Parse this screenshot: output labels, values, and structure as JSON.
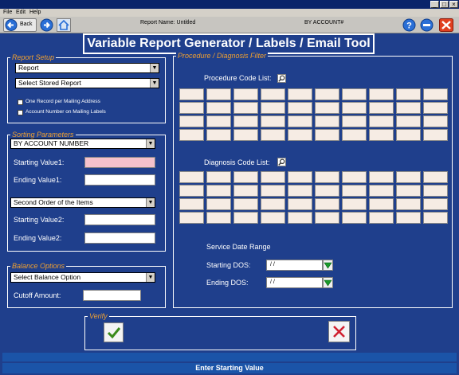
{
  "menu": {
    "file": "File",
    "edit": "Edit",
    "help": "Help"
  },
  "toolbar": {
    "back_label": "Back",
    "report_name": "Report Name: Untitled",
    "sort_info": "BY ACCOUNT#"
  },
  "header": {
    "title": "Variable Report Generator / Labels / Email Tool"
  },
  "report_setup": {
    "legend": "Report Setup",
    "report_type": "Report",
    "stored_report": "Select Stored Report",
    "one_record_label": "One Record per Mailing Address",
    "account_number_label": "Account Number on Mailing Labels"
  },
  "sorting": {
    "legend": "Sorting Parameters",
    "first_order": "BY ACCOUNT NUMBER",
    "starting_value1_label": "Starting Value1:",
    "ending_value1_label": "Ending   Value1:",
    "second_order": "Second Order of the Items",
    "starting_value2_label": "Starting Value2:",
    "ending_value2_label": "Ending   Value2:"
  },
  "balance": {
    "legend": "Balance Options",
    "option": "Select Balance Option",
    "cutoff_label": "Cutoff Amount:"
  },
  "filter": {
    "legend": "Procedure / Diagnosis Filter",
    "procedure_label": "Procedure Code List:",
    "diagnosis_label": "Diagnosis Code List:",
    "service_date_label": "Service Date Range",
    "starting_dos_label": "Starting DOS:",
    "starting_dos_value": "/ /",
    "ending_dos_label": "Ending   DOS:",
    "ending_dos_value": "/ /"
  },
  "verify": {
    "legend": "Verify"
  },
  "status": {
    "message": "Enter Starting Value"
  },
  "colors": {
    "background": "#1f3f8c",
    "legend": "#f0a030",
    "pink_field": "#f5c2cc",
    "status_bar": "#1b54a8"
  }
}
